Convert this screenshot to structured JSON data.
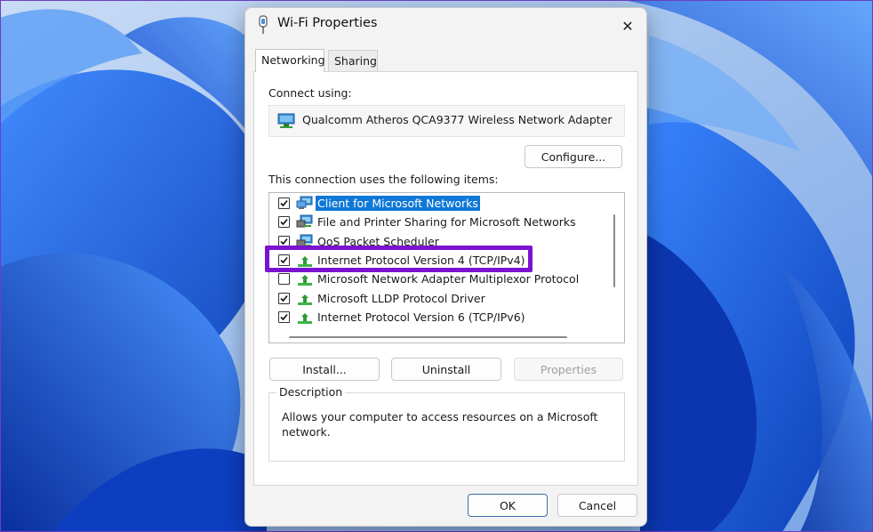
{
  "window": {
    "title": "Wi-Fi Properties",
    "close_glyph": "✕",
    "tabs": [
      {
        "label": "Networking",
        "active": true
      },
      {
        "label": "Sharing",
        "active": false
      }
    ]
  },
  "networking": {
    "connect_using_label": "Connect using:",
    "adapter_name": "Qualcomm Atheros QCA9377 Wireless Network Adapter",
    "configure_button": "Configure...",
    "items_label": "This connection uses the following items:",
    "items": [
      {
        "label": "Client for Microsoft Networks",
        "checked": true,
        "icon": "network-client-icon",
        "selected": true
      },
      {
        "label": "File and Printer Sharing for Microsoft Networks",
        "checked": true,
        "icon": "network-service-icon",
        "selected": false
      },
      {
        "label": "QoS Packet Scheduler",
        "checked": true,
        "icon": "network-service-icon",
        "selected": false
      },
      {
        "label": "Internet Protocol Version 4 (TCP/IPv4)",
        "checked": true,
        "icon": "protocol-icon",
        "selected": false,
        "highlighted": true
      },
      {
        "label": "Microsoft Network Adapter Multiplexor Protocol",
        "checked": false,
        "icon": "protocol-icon",
        "selected": false
      },
      {
        "label": "Microsoft LLDP Protocol Driver",
        "checked": true,
        "icon": "protocol-icon",
        "selected": false
      },
      {
        "label": "Internet Protocol Version 6 (TCP/IPv6)",
        "checked": true,
        "icon": "protocol-icon",
        "selected": false
      }
    ],
    "install_button": "Install...",
    "uninstall_button": "Uninstall",
    "properties_button": "Properties",
    "description_legend": "Description",
    "description_text": "Allows your computer to access resources on a Microsoft network."
  },
  "footer": {
    "ok_button": "OK",
    "cancel_button": "Cancel"
  },
  "colors": {
    "selection": "#0f78d7",
    "highlight_annotation": "#7b12d0",
    "wallpaper_accent": "#1d5fe0"
  }
}
